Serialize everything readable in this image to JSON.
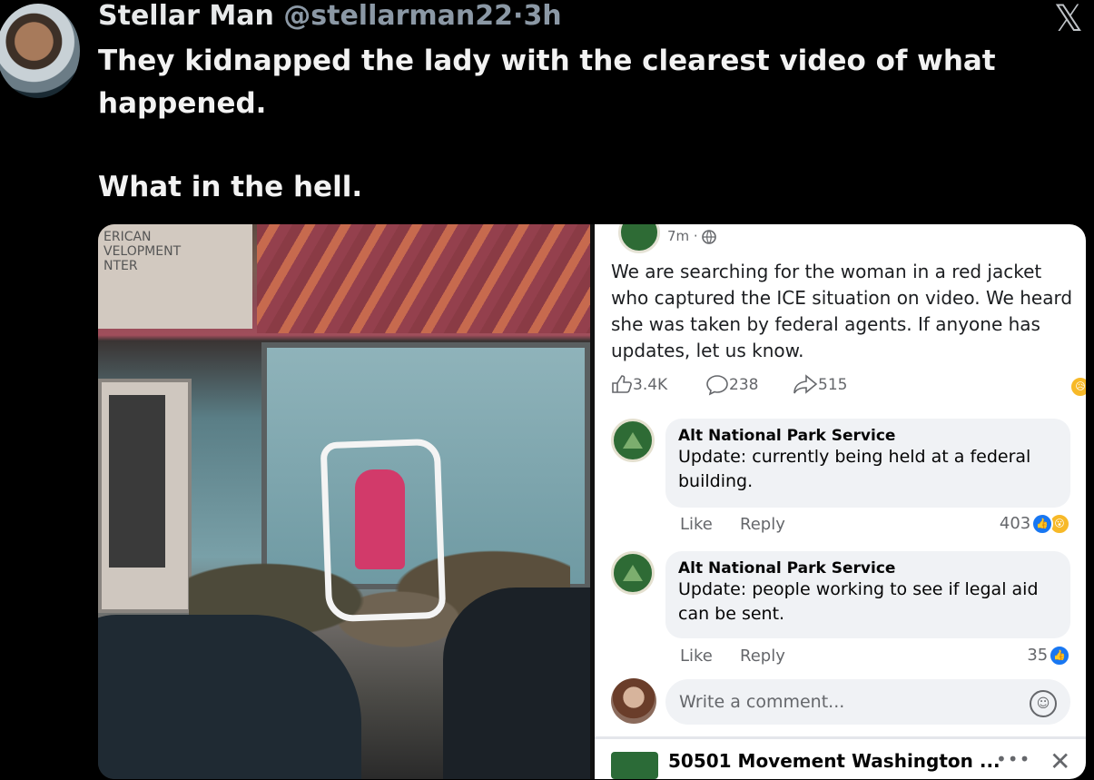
{
  "tweet": {
    "author_name": "Stellar Man",
    "author_handle": "@stellarman22",
    "separator": "·",
    "time": "3h",
    "x_logo": "𝕏",
    "text_line1": "They kidnapped the lady with the clearest video of what happened.",
    "text_line2": "What in the hell."
  },
  "photo": {
    "sign_lines": [
      "ERICAN",
      "VELOPMENT",
      "NTER"
    ]
  },
  "fb": {
    "post_time": "7m ·",
    "post_text": "We are searching for the woman in a red jacket who captured the ICE situation on video. We heard she was taken by federal agents. If anyone has updates, let us know.",
    "likes": "3.4K",
    "comments": "238",
    "shares": "515",
    "comment_list": [
      {
        "name": "Alt National Park Service",
        "text": "Update: currently being held at a federal building.",
        "like_label": "Like",
        "reply_label": "Reply",
        "count": "403"
      },
      {
        "name": "Alt National Park Service",
        "text": "Update: people working to see if legal aid can be sent.",
        "like_label": "Like",
        "reply_label": "Reply",
        "count": "35"
      }
    ],
    "write_placeholder": "Write a comment...",
    "bottom_title": "50501 Movement Washington ...",
    "more_label": "•••",
    "close_label": "✕"
  }
}
